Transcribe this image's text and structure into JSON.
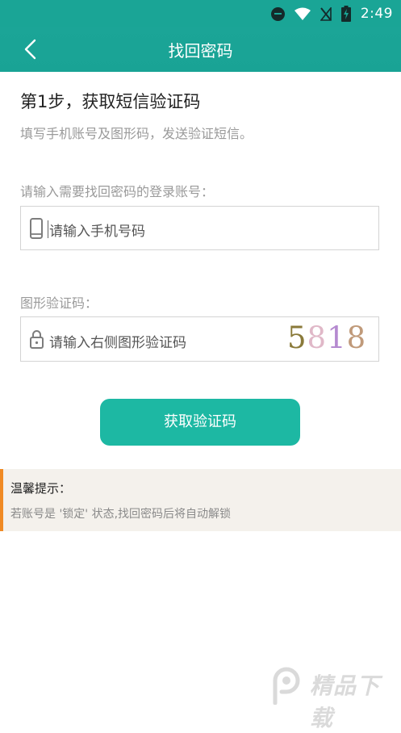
{
  "status_bar": {
    "time": "2:49",
    "icons": [
      "do-not-disturb-icon",
      "wifi-icon",
      "no-signal-icon",
      "battery-charging-icon"
    ]
  },
  "app_bar": {
    "title": "找回密码",
    "back_icon": "chevron-left-icon"
  },
  "step": {
    "title": "第1步，获取短信验证码",
    "description": "填写手机账号及图形码，发送验证短信。"
  },
  "account": {
    "label": "请输入需要找回密码的登录账号：",
    "placeholder": "请输入手机号码",
    "icon": "phone-icon"
  },
  "captcha": {
    "label": "图形验证码：",
    "placeholder": "请输入右侧图形验证码",
    "icon": "lock-icon",
    "code": [
      "5",
      "8",
      "1",
      "8"
    ]
  },
  "submit": {
    "label": "获取验证码"
  },
  "tips": {
    "title": "温馨提示：",
    "text": "若账号是 '锁定' 状态,找回密码后将自动解锁"
  },
  "watermark": {
    "text": "精品下载"
  },
  "colors": {
    "primary": "#1aa596",
    "button": "#1db8a3",
    "tips_accent": "#f08a24",
    "tips_background": "#f4f1ec"
  }
}
